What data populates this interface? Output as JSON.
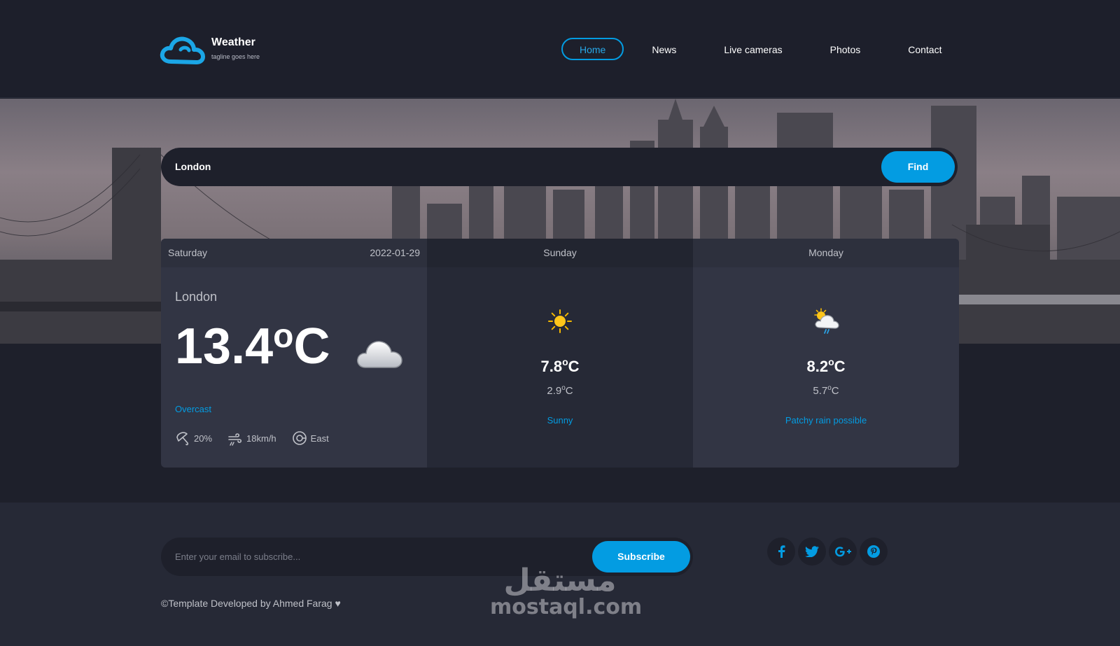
{
  "brand": {
    "title": "Weather",
    "tagline": "tagline goes here",
    "logo_icon": "cloud-logo-icon",
    "accent_color": "#039ce2"
  },
  "nav": {
    "items": [
      {
        "label": "Home",
        "active": true
      },
      {
        "label": "News",
        "active": false
      },
      {
        "label": "Live cameras",
        "active": false
      },
      {
        "label": "Photos",
        "active": false
      },
      {
        "label": "Contact",
        "active": false
      }
    ]
  },
  "search": {
    "value": "London",
    "button_label": "Find"
  },
  "forecast": {
    "today": {
      "day": "Saturday",
      "date": "2022-01-29",
      "location": "London",
      "temp": "13.4",
      "unit_deg": "o",
      "unit_c": "C",
      "icon": "overcast-cloud-icon",
      "condition": "Overcast",
      "rain": "20%",
      "wind": "18km/h",
      "direction": "East"
    },
    "day2": {
      "day": "Sunday",
      "icon": "sun-icon",
      "max": "7.8",
      "min": "2.9",
      "condition": "Sunny"
    },
    "day3": {
      "day": "Monday",
      "icon": "patchy-rain-icon",
      "max": "8.2",
      "min": "5.7",
      "condition": "Patchy rain possible"
    }
  },
  "footer": {
    "subscribe_placeholder": "Enter your email to subscribe...",
    "subscribe_button": "Subscribe",
    "social": [
      "facebook-icon",
      "twitter-icon",
      "google-plus-icon",
      "pinterest-icon"
    ],
    "copyright": "©Template Developed by Ahmed Farag ♥"
  },
  "watermark": {
    "arabic": "مستقل",
    "latin": "mostaql.com"
  }
}
